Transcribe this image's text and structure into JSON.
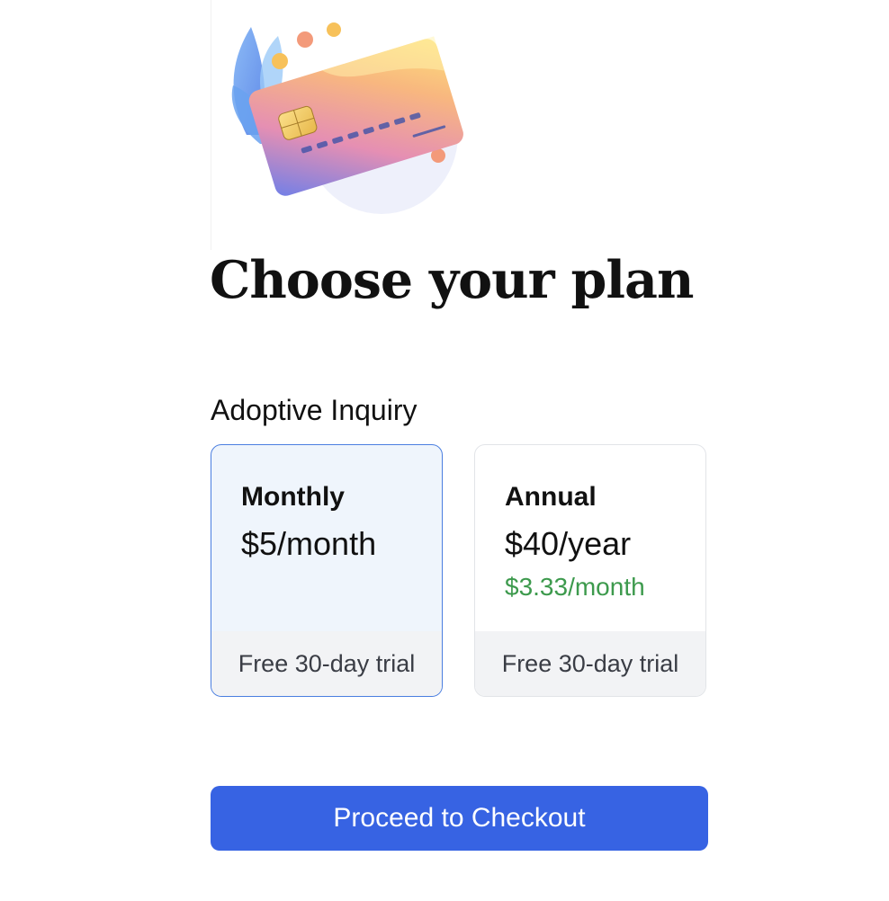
{
  "header": {
    "illustration": "credit-card-illustration",
    "title": "Choose your plan"
  },
  "product": {
    "name": "Adoptive Inquiry"
  },
  "plans": [
    {
      "name": "Monthly",
      "price": "$5/month",
      "sub_price": "",
      "footer": "Free 30-day trial",
      "selected": true
    },
    {
      "name": "Annual",
      "price": "$40/year",
      "sub_price": "$3.33/month",
      "footer": "Free 30-day trial",
      "selected": false
    }
  ],
  "actions": {
    "checkout_label": "Proceed to Checkout"
  },
  "colors": {
    "accent": "#3763e3",
    "selected_border": "#4a7ee0",
    "selected_bg": "#eff5fc",
    "savings_green": "#3d9a4d"
  }
}
